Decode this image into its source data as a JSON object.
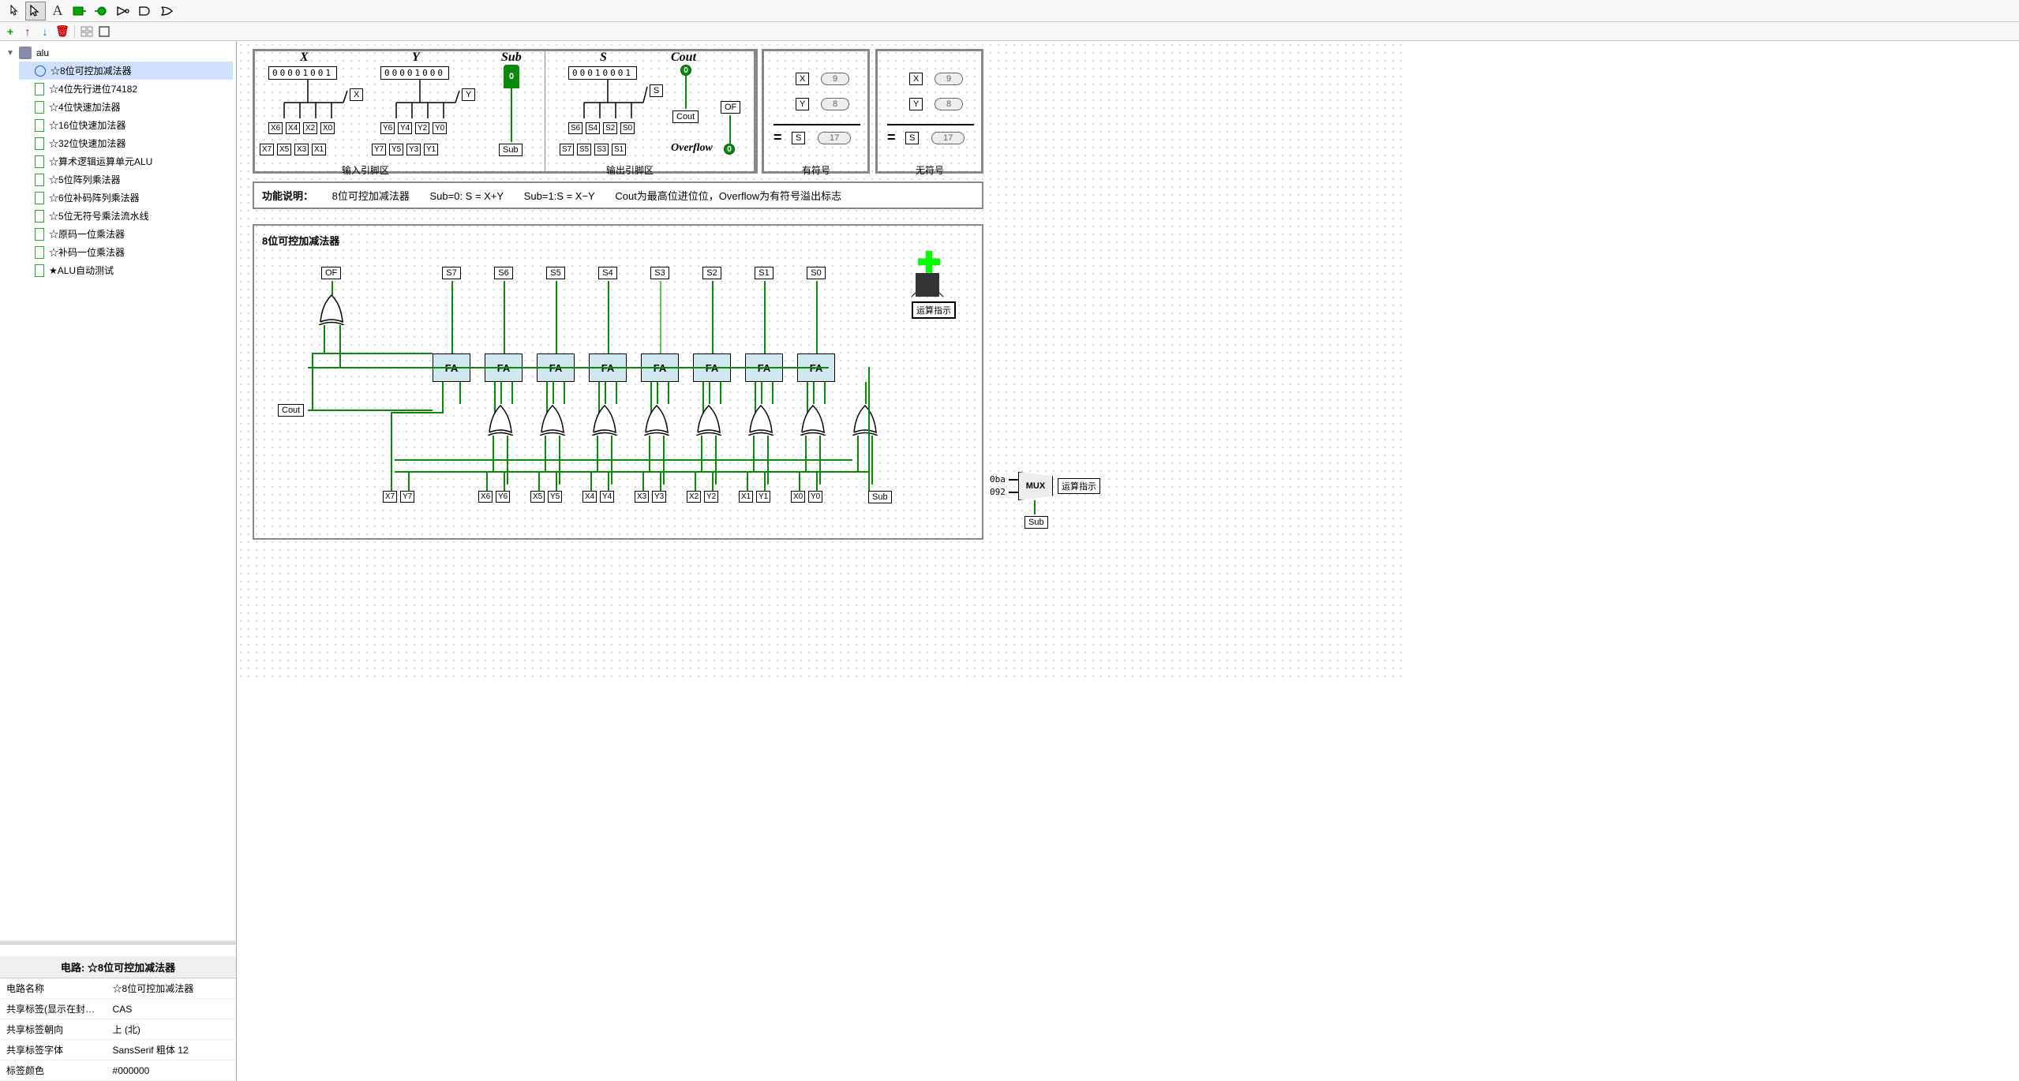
{
  "toolbar": {
    "tools": [
      "poke",
      "select",
      "text",
      "input-pin",
      "output-pin",
      "not-gate",
      "and-gate",
      "or-gate"
    ]
  },
  "tree": {
    "root": "alu",
    "items": [
      "☆8位可控加减法器",
      "☆4位先行进位74182",
      "☆4位快速加法器",
      "☆16位快速加法器",
      "☆32位快速加法器",
      "☆算术逻辑运算单元ALU",
      "☆5位阵列乘法器",
      "☆6位补码阵列乘法器",
      "☆5位无符号乘法流水线",
      "☆原码一位乘法器",
      "☆补码一位乘法器",
      "★ALU自动测试"
    ]
  },
  "props": {
    "header": "电路: ☆8位可控加减法器",
    "rows": [
      [
        "电路名称",
        "☆8位可控加减法器"
      ],
      [
        "共享标签(显示在封…",
        "CAS"
      ],
      [
        "共享标签朝向",
        "上 (北)"
      ],
      [
        "共享标签字体",
        "SansSerif 粗体 12"
      ],
      [
        "标签颜色",
        "#000000"
      ]
    ]
  },
  "headers": {
    "x": "X",
    "y": "Y",
    "sub": "Sub",
    "s": "S",
    "cout": "Cout",
    "x_bits": "00001001",
    "y_bits": "00001000",
    "s_bits": "00010001",
    "x_pins_top": [
      "X6",
      "X4",
      "X2",
      "X0"
    ],
    "x_pins_bot": [
      "X7",
      "X5",
      "X3",
      "X1"
    ],
    "y_pins_top": [
      "Y6",
      "Y4",
      "Y2",
      "Y0"
    ],
    "y_pins_bot": [
      "Y7",
      "Y5",
      "Y3",
      "Y1"
    ],
    "s_pins_top": [
      "S6",
      "S4",
      "S2",
      "S0"
    ],
    "s_pins_bot": [
      "S7",
      "S5",
      "S3",
      "S1"
    ],
    "x_pin": "X",
    "y_pin": "Y",
    "s_pin": "S",
    "sub_pin": "Sub",
    "sub_val": "0",
    "cout_pin": "Cout",
    "cout_val": "0",
    "of_pin": "OF",
    "overflow_label": "Overflow",
    "of_val": "0",
    "input_area": "输入引脚区",
    "output_area": "输出引脚区",
    "signed_label": "有符号",
    "unsigned_label": "无符号"
  },
  "signed": {
    "x": "X",
    "xv": "9",
    "y": "Y",
    "yv": "8",
    "s": "S",
    "sv": "17"
  },
  "unsigned": {
    "x": "X",
    "xv": "9",
    "y": "Y",
    "yv": "8",
    "s": "S",
    "sv": "17"
  },
  "desc": {
    "label": "功能说明：",
    "t1": "8位可控加减法器",
    "t2": "Sub=0: S = X+Y",
    "t3": "Sub=1:S = X−Y",
    "t4": "Cout为最高位进位位，Overflow为有符号溢出标志"
  },
  "circuit": {
    "title": "8位可控加减法器",
    "of": "OF",
    "cout": "Cout",
    "s_outs": [
      "S7",
      "S6",
      "S5",
      "S4",
      "S3",
      "S2",
      "S1",
      "S0"
    ],
    "fa": "FA",
    "xy_pairs": [
      [
        "X7",
        "Y7"
      ],
      [
        "X6",
        "Y6"
      ],
      [
        "X5",
        "Y5"
      ],
      [
        "X4",
        "Y4"
      ],
      [
        "X3",
        "Y3"
      ],
      [
        "X2",
        "Y2"
      ],
      [
        "X1",
        "Y1"
      ],
      [
        "X0",
        "Y0"
      ]
    ],
    "sub": "Sub",
    "ops_indicator": "运算指示",
    "mux": "MUX",
    "mux_in0": "0ba",
    "mux_in1": "092",
    "mux_out": "运算指示",
    "mux_sel": "Sub"
  }
}
